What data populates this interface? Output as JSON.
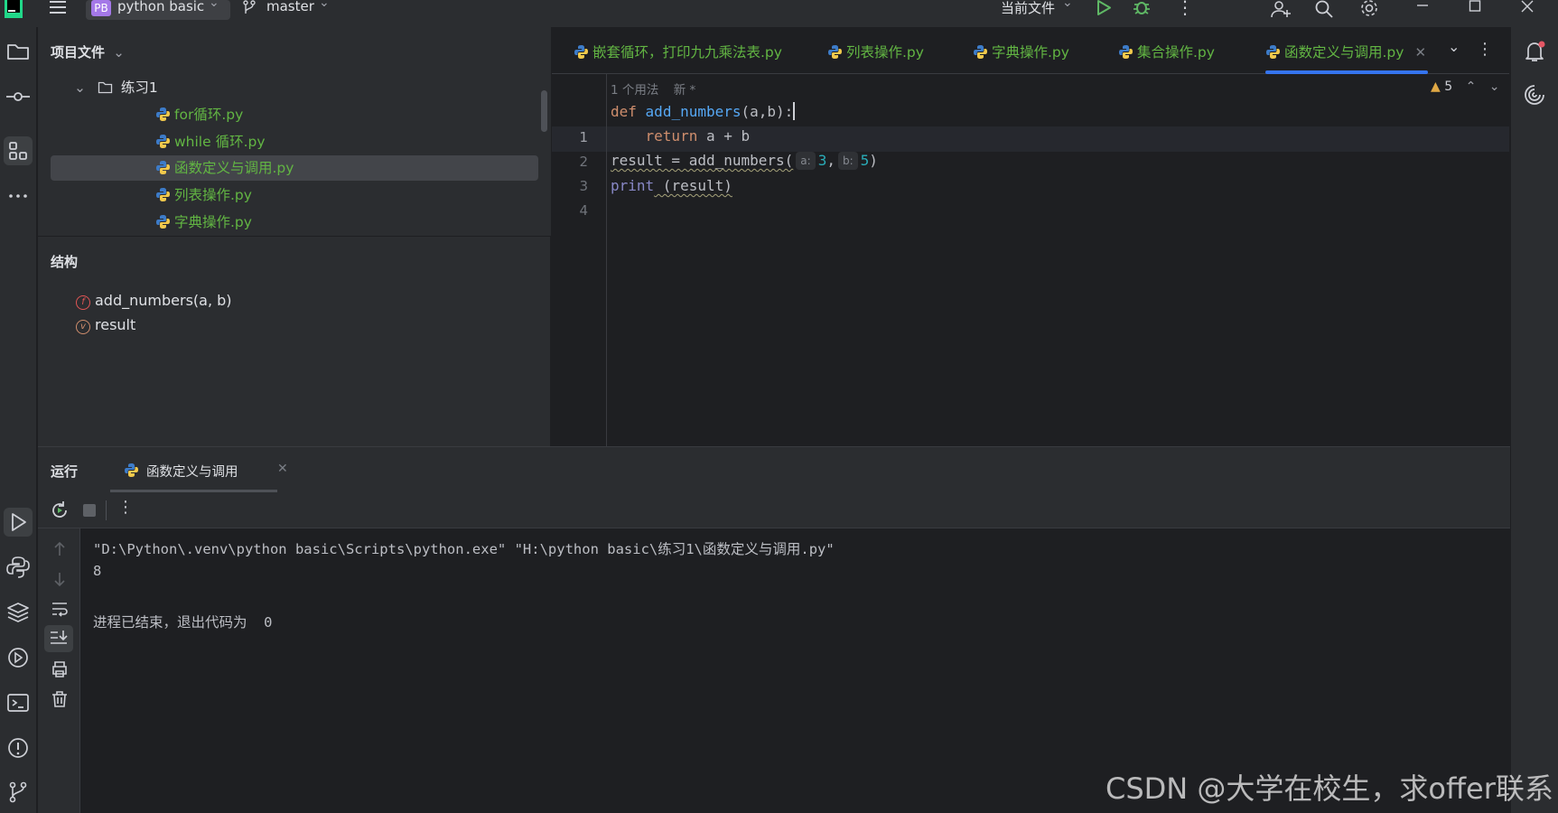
{
  "titlebar": {
    "project_badge": "PB",
    "project_name": "python basic",
    "branch": "master",
    "run_config": "当前文件"
  },
  "project_panel": {
    "header": "项目文件",
    "folder": "练习1",
    "files": [
      "for循环.py",
      "while 循环.py",
      "函数定义与调用.py",
      "列表操作.py",
      "字典操作.py"
    ],
    "selected_index": 2
  },
  "structure_panel": {
    "header": "结构",
    "items": [
      {
        "badge": "f",
        "label": "add_numbers(a, b)"
      },
      {
        "badge": "v",
        "label": "result"
      }
    ]
  },
  "editor": {
    "tabs": [
      "嵌套循环，打印九九乘法表.py",
      "列表操作.py",
      "字典操作.py",
      "集合操作.py",
      "函数定义与调用.py"
    ],
    "active_tab": 4,
    "usage_hint": "1 个用法",
    "new_hint": "新 *",
    "warning_count": "5",
    "line_numbers": [
      "1",
      "2",
      "3",
      "4"
    ],
    "code": {
      "l1_kw": "def",
      "l1_fn": "add_numbers",
      "l1_rest": "(a,b):",
      "l2_kw": "return",
      "l2_rest": " a + b",
      "l3_a": "result = add_numbers(",
      "l3_hint_a": "a:",
      "l3_val_a": "3",
      "l3_hint_b": "b:",
      "l3_val_b": "5",
      "l3_end": ")",
      "l4_fn": "print",
      "l4_rest": " (result)"
    }
  },
  "run_panel": {
    "label": "运行",
    "tab": "函数定义与调用",
    "output": [
      "\"D:\\Python\\.venv\\python basic\\Scripts\\python.exe\" \"H:\\python basic\\练习1\\函数定义与调用.py\"",
      "8",
      "",
      "进程已结束，退出代码为  0"
    ]
  },
  "watermark": "CSDN @大学在校生，求offer联系",
  "colors": {
    "accent": "#3574f0",
    "file_green": "#62b543",
    "keyword": "#cf8e6d",
    "function": "#56a8f5",
    "number": "#2aacb8"
  }
}
